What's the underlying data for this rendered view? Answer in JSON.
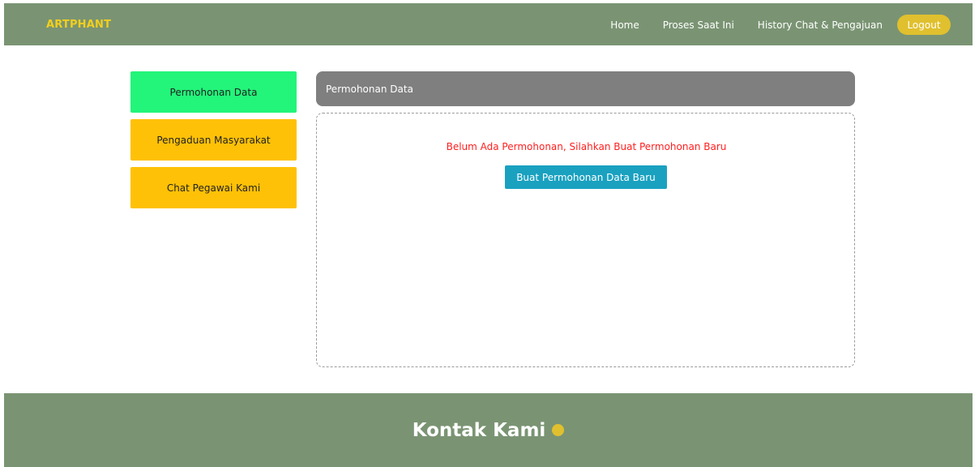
{
  "navbar": {
    "brand": "ARTPHANT",
    "links": [
      "Home",
      "Proses Saat Ini",
      "History Chat & Pengajuan"
    ],
    "logout": "Logout"
  },
  "sidebar": {
    "items": [
      {
        "label": "Permohonan Data"
      },
      {
        "label": "Pengaduan Masyarakat"
      },
      {
        "label": "Chat Pegawai Kami"
      }
    ]
  },
  "panel": {
    "title": "Permohonan Data",
    "empty_message": "Belum Ada Permohonan, Silahkan Buat Permohonan Baru",
    "create_button": "Buat Permohonan Data Baru"
  },
  "footer": {
    "title": "Kontak Kami"
  },
  "colors": {
    "nav_bg": "#7a9473",
    "brand": "#f2cf1d",
    "active": "#22f57a",
    "inactive": "#ffc107",
    "button": "#1aa1c0",
    "alert": "#ff1f1f"
  }
}
